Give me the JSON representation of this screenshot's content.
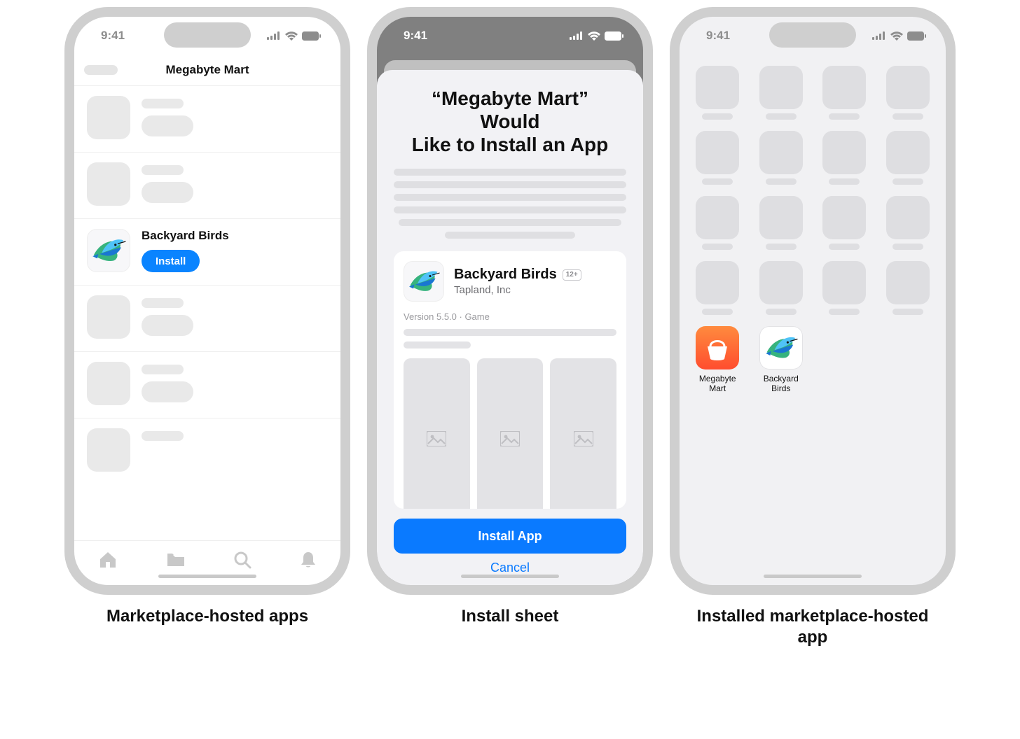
{
  "status": {
    "time": "9:41"
  },
  "phone1": {
    "caption": "Marketplace-hosted apps",
    "nav_title": "Megabyte Mart",
    "featured": {
      "app_name": "Backyard Birds",
      "install_label": "Install"
    }
  },
  "phone2": {
    "caption": "Install sheet",
    "title_line1": "“Megabyte Mart” Would",
    "title_line2": "Like to Install an App",
    "card": {
      "app_name": "Backyard Birds",
      "age_rating": "12+",
      "developer": "Tapland, Inc",
      "meta": "Version 5.5.0 · Game"
    },
    "primary_label": "Install App",
    "cancel_label": "Cancel"
  },
  "phone3": {
    "caption": "Installed marketplace-hosted app",
    "apps": {
      "megabyte_mart": "Megabyte\nMart",
      "backyard_birds": "Backyard\nBirds"
    }
  }
}
